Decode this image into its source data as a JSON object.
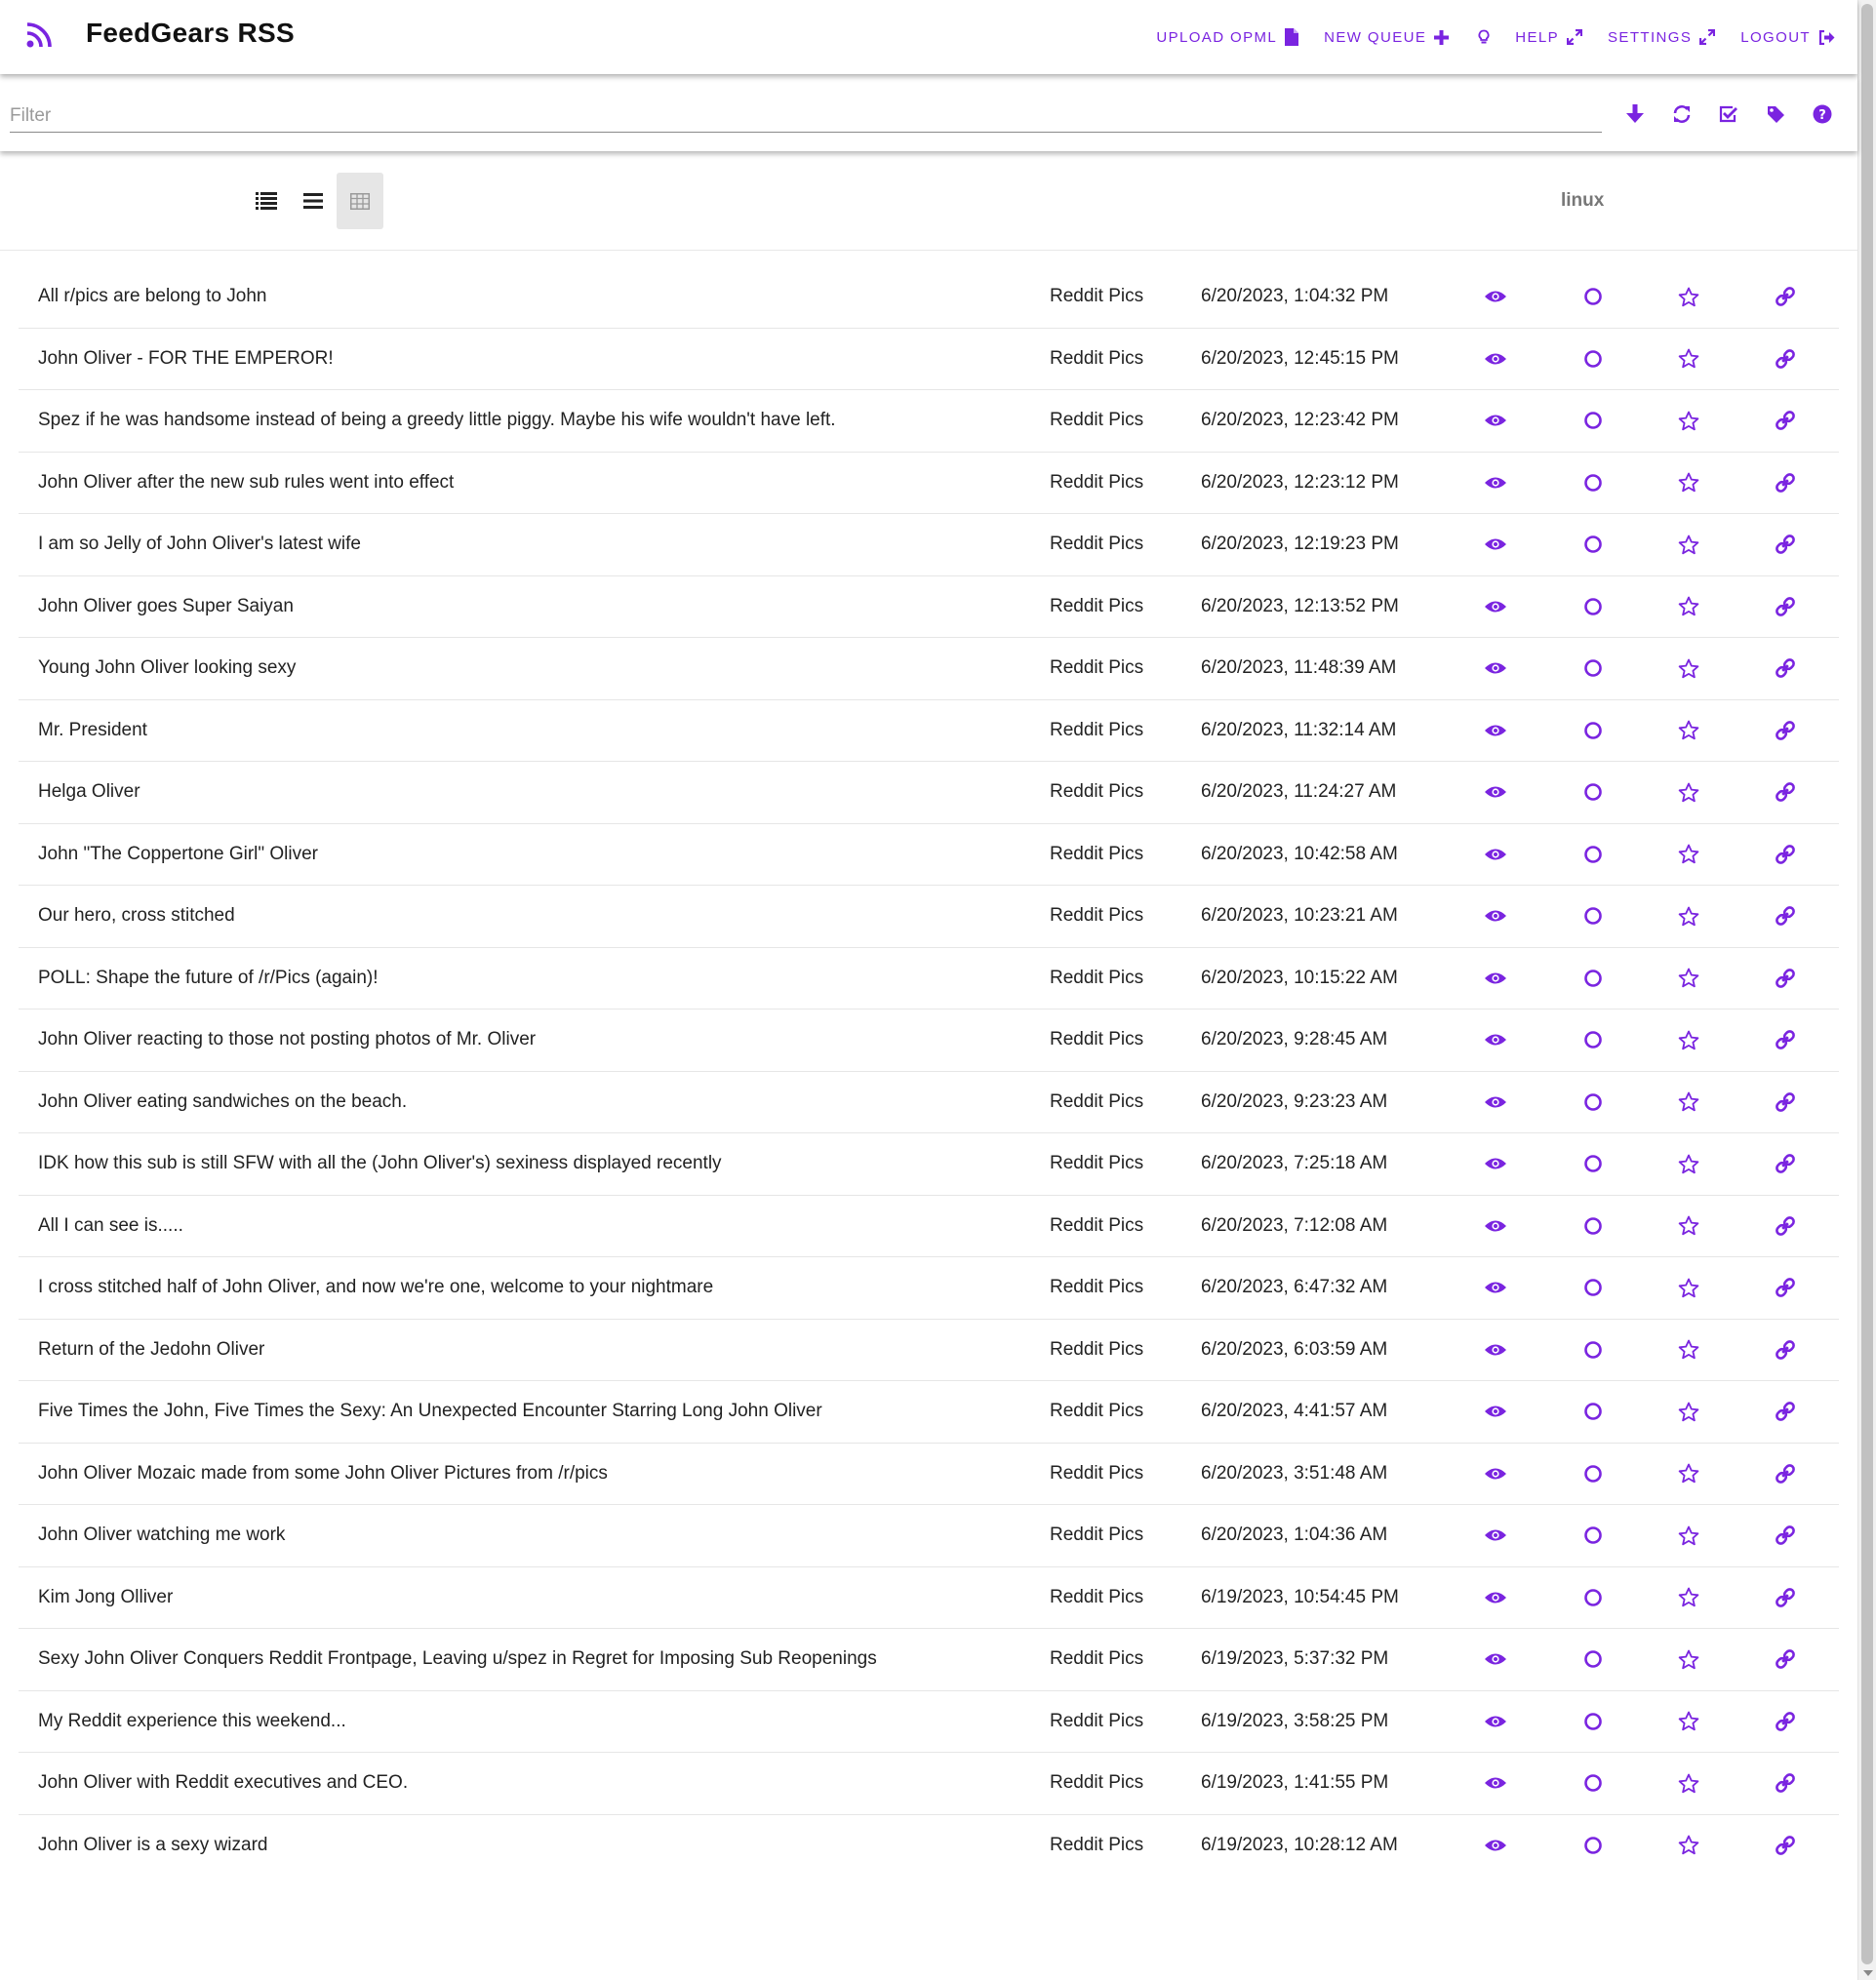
{
  "app": {
    "title": "FeedGears RSS"
  },
  "colors": {
    "accent": "#7a24e0"
  },
  "nav": {
    "upload_opml": "UPLOAD OPML",
    "new_queue": "NEW QUEUE",
    "help": "HELP",
    "settings": "SETTINGS",
    "logout": "LOGOUT"
  },
  "filter": {
    "placeholder": "Filter",
    "value": ""
  },
  "toolbar_icons": [
    "arrow-down-icon",
    "refresh-icon",
    "check-square-icon",
    "tag-icon",
    "question-circle-icon"
  ],
  "view_modes": [
    {
      "icon": "list-detailed-icon",
      "active": false
    },
    {
      "icon": "list-icon",
      "active": false
    },
    {
      "icon": "table-grid-icon",
      "active": true
    }
  ],
  "queue": {
    "label": "linux"
  },
  "items": [
    {
      "title": "All r/pics are belong to John",
      "source": "Reddit Pics",
      "date": "6/20/2023, 1:04:32 PM"
    },
    {
      "title": "John Oliver - FOR THE EMPEROR!",
      "source": "Reddit Pics",
      "date": "6/20/2023, 12:45:15 PM"
    },
    {
      "title": "Spez if he was handsome instead of being a greedy little piggy. Maybe his wife wouldn't have left.",
      "source": "Reddit Pics",
      "date": "6/20/2023, 12:23:42 PM"
    },
    {
      "title": "John Oliver after the new sub rules went into effect",
      "source": "Reddit Pics",
      "date": "6/20/2023, 12:23:12 PM"
    },
    {
      "title": "I am so Jelly of John Oliver's latest wife",
      "source": "Reddit Pics",
      "date": "6/20/2023, 12:19:23 PM"
    },
    {
      "title": "John Oliver goes Super Saiyan",
      "source": "Reddit Pics",
      "date": "6/20/2023, 12:13:52 PM"
    },
    {
      "title": "Young John Oliver looking sexy",
      "source": "Reddit Pics",
      "date": "6/20/2023, 11:48:39 AM"
    },
    {
      "title": "Mr. President",
      "source": "Reddit Pics",
      "date": "6/20/2023, 11:32:14 AM"
    },
    {
      "title": "Helga Oliver",
      "source": "Reddit Pics",
      "date": "6/20/2023, 11:24:27 AM"
    },
    {
      "title": "John \"The Coppertone Girl\" Oliver",
      "source": "Reddit Pics",
      "date": "6/20/2023, 10:42:58 AM"
    },
    {
      "title": "Our hero, cross stitched",
      "source": "Reddit Pics",
      "date": "6/20/2023, 10:23:21 AM"
    },
    {
      "title": "POLL: Shape the future of /r/Pics (again)!",
      "source": "Reddit Pics",
      "date": "6/20/2023, 10:15:22 AM"
    },
    {
      "title": "John Oliver reacting to those not posting photos of Mr. Oliver",
      "source": "Reddit Pics",
      "date": "6/20/2023, 9:28:45 AM"
    },
    {
      "title": "John Oliver eating sandwiches on the beach.",
      "source": "Reddit Pics",
      "date": "6/20/2023, 9:23:23 AM"
    },
    {
      "title": "IDK how this sub is still SFW with all the (John Oliver's) sexiness displayed recently",
      "source": "Reddit Pics",
      "date": "6/20/2023, 7:25:18 AM"
    },
    {
      "title": "All I can see is.....",
      "source": "Reddit Pics",
      "date": "6/20/2023, 7:12:08 AM"
    },
    {
      "title": "I cross stitched half of John Oliver, and now we're one, welcome to your nightmare",
      "source": "Reddit Pics",
      "date": "6/20/2023, 6:47:32 AM"
    },
    {
      "title": "Return of the Jedohn Oliver",
      "source": "Reddit Pics",
      "date": "6/20/2023, 6:03:59 AM"
    },
    {
      "title": "Five Times the John, Five Times the Sexy: An Unexpected Encounter Starring Long John Oliver",
      "source": "Reddit Pics",
      "date": "6/20/2023, 4:41:57 AM"
    },
    {
      "title": "John Oliver Mozaic made from some John Oliver Pictures from /r/pics",
      "source": "Reddit Pics",
      "date": "6/20/2023, 3:51:48 AM"
    },
    {
      "title": "John Oliver watching me work",
      "source": "Reddit Pics",
      "date": "6/20/2023, 1:04:36 AM"
    },
    {
      "title": "Kim Jong Olliver",
      "source": "Reddit Pics",
      "date": "6/19/2023, 10:54:45 PM"
    },
    {
      "title": "Sexy John Oliver Conquers Reddit Frontpage, Leaving u/spez in Regret for Imposing Sub Reopenings",
      "source": "Reddit Pics",
      "date": "6/19/2023, 5:37:32 PM"
    },
    {
      "title": "My Reddit experience this weekend...",
      "source": "Reddit Pics",
      "date": "6/19/2023, 3:58:25 PM"
    },
    {
      "title": "John Oliver with Reddit executives and CEO.",
      "source": "Reddit Pics",
      "date": "6/19/2023, 1:41:55 PM"
    },
    {
      "title": "John Oliver is a sexy wizard",
      "source": "Reddit Pics",
      "date": "6/19/2023, 10:28:12 AM"
    }
  ]
}
